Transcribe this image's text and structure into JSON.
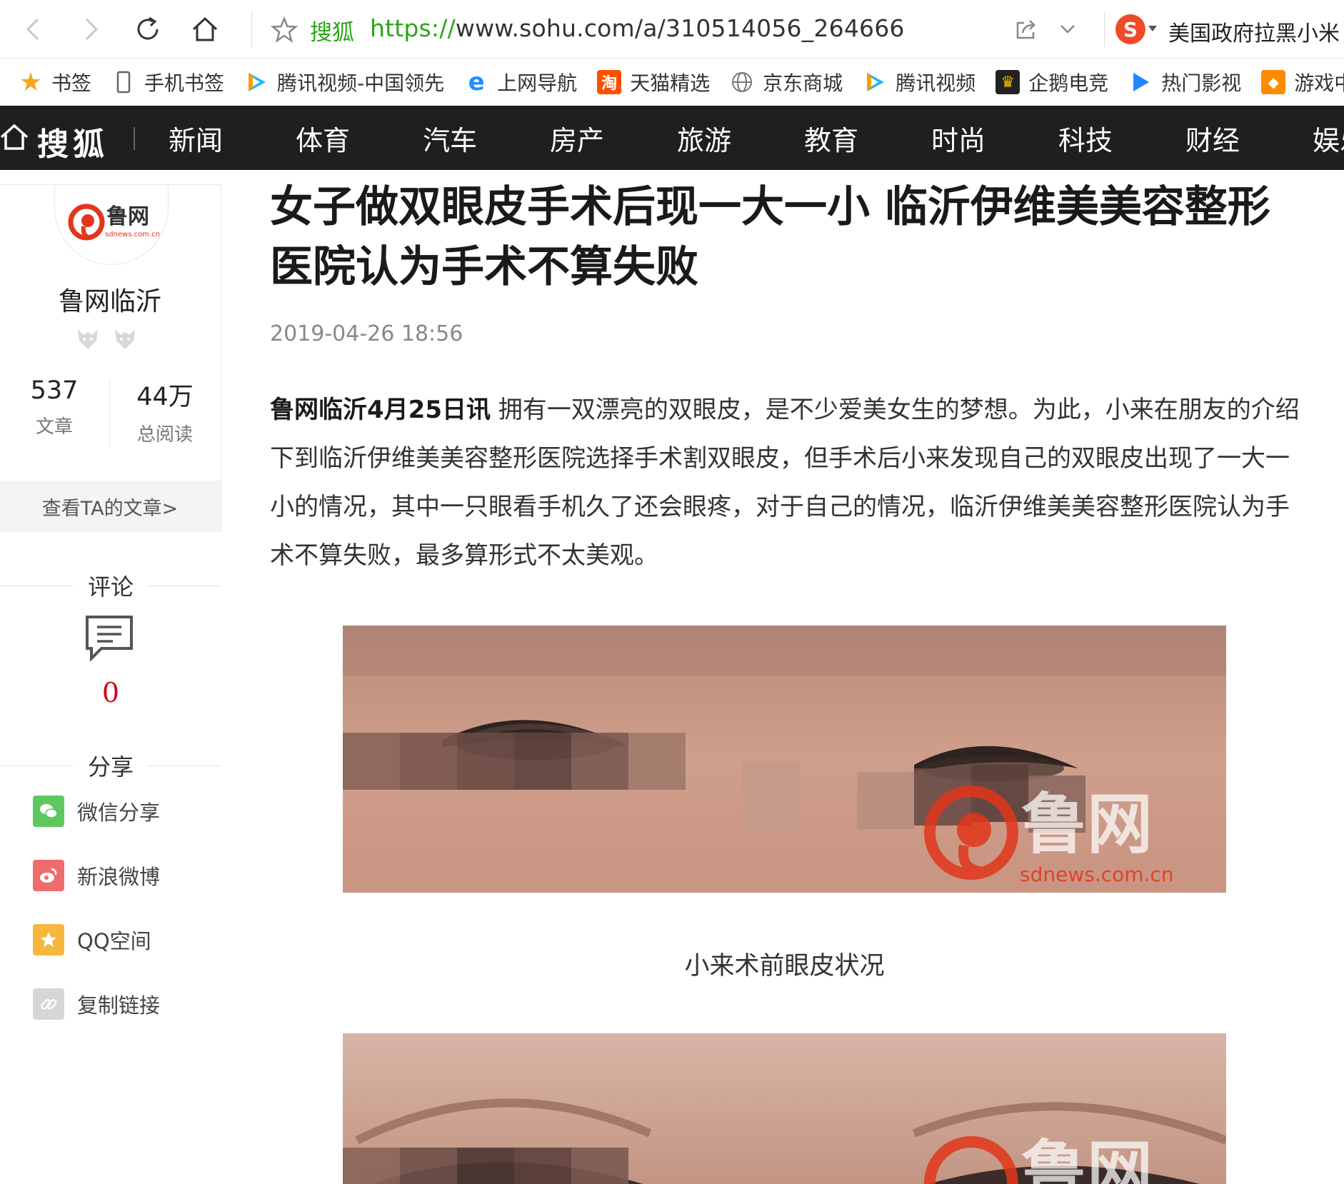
{
  "browser": {
    "site_name": "搜狐",
    "url_protocol": "https://",
    "url_rest": "www.sohu.com/a/310514056_264666",
    "hot_search": "美国政府拉黑小米"
  },
  "bookmarks": [
    {
      "label": "书签",
      "icon": "star-icon"
    },
    {
      "label": "手机书签",
      "icon": "phone-icon"
    },
    {
      "label": "腾讯视频-中国领先",
      "icon": "tencent-video-icon"
    },
    {
      "label": "上网导航",
      "icon": "ie-icon"
    },
    {
      "label": "天猫精选",
      "icon": "taobao-icon"
    },
    {
      "label": "京东商城",
      "icon": "globe-icon"
    },
    {
      "label": "腾讯视频",
      "icon": "tencent-video-icon"
    },
    {
      "label": "企鹅电竞",
      "icon": "penguin-esports-icon"
    },
    {
      "label": "热门影视",
      "icon": "play-icon"
    },
    {
      "label": "游戏中",
      "icon": "gamepad-icon"
    }
  ],
  "sohu_nav": {
    "logo": "搜狐",
    "items": [
      "新闻",
      "体育",
      "汽车",
      "房产",
      "旅游",
      "教育",
      "时尚",
      "科技",
      "财经",
      "娱乐"
    ]
  },
  "author": {
    "name": "鲁网临沂",
    "logo_text": "鲁网",
    "logo_domain": "sdnews.com.cn",
    "articles_count": "537",
    "articles_label": "文章",
    "reads_count": "44万",
    "reads_label": "总阅读",
    "view_articles": "查看TA的文章>"
  },
  "comments": {
    "heading": "评论",
    "count": "0"
  },
  "share": {
    "heading": "分享",
    "items": [
      {
        "label": "微信分享",
        "icon": "wechat-icon",
        "color": "#5ec85e"
      },
      {
        "label": "新浪微博",
        "icon": "weibo-icon",
        "color": "#f06c6c"
      },
      {
        "label": "QQ空间",
        "icon": "qzone-icon",
        "color": "#f6b73c"
      },
      {
        "label": "复制链接",
        "icon": "link-icon",
        "color": "#d6d6d6"
      }
    ]
  },
  "article": {
    "title": "女子做双眼皮手术后现一大一小 临沂伊维美美容整形医院认为手术不算失败",
    "published": "2019-04-26 18:56",
    "lead_source": "鲁网临沂4月25日讯",
    "lead_text": " 拥有一双漂亮的双眼皮，是不少爱美女生的梦想。为此，小来在朋友的介绍下到临沂伊维美美容整形医院选择手术割双眼皮，但手术后小来发现自己的双眼皮出现了一大一小的情况，其中一只眼看手机久了还会眼疼，对于自己的情况，临沂伊维美美容整形医院认为手术不算失败，最多算形式不太美观。",
    "image1_caption": "小来术前眼皮状况",
    "watermark_text": "鲁网",
    "watermark_domain": "sdnews.com.cn"
  },
  "colors": {
    "nav_bg": "#1f1f1f",
    "accent_green": "#2aa515",
    "comment_red": "#d0021b"
  }
}
